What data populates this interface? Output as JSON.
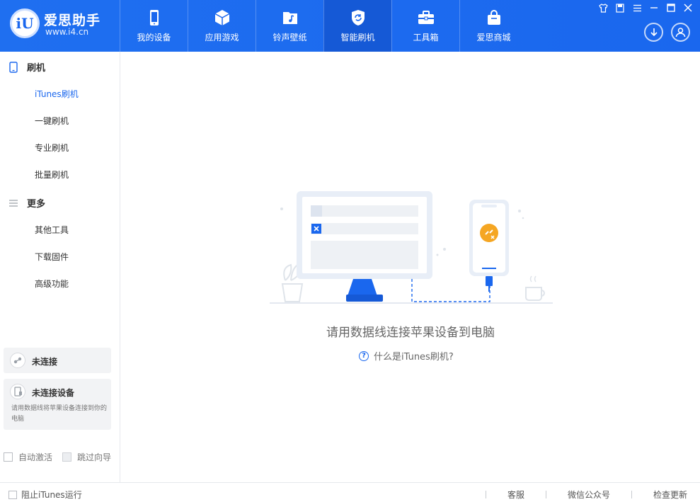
{
  "app": {
    "logo_text": "爱思助手",
    "logo_url": "www.i4.cn",
    "logo_badge": "iU"
  },
  "nav": [
    {
      "label": "我的设备",
      "icon": "phone-icon"
    },
    {
      "label": "应用游戏",
      "icon": "cube-icon"
    },
    {
      "label": "铃声壁纸",
      "icon": "music-folder-icon"
    },
    {
      "label": "智能刷机",
      "icon": "refresh-shield-icon",
      "active": true
    },
    {
      "label": "工具箱",
      "icon": "toolbox-icon"
    },
    {
      "label": "爱思商城",
      "icon": "shopping-bag-icon"
    }
  ],
  "sidebar": {
    "section_flash": "刷机",
    "flash_items": [
      "iTunes刷机",
      "一键刷机",
      "专业刷机",
      "批量刷机"
    ],
    "section_more": "更多",
    "more_items": [
      "其他工具",
      "下载固件",
      "高级功能"
    ],
    "status_card": {
      "title": "未连接"
    },
    "device_card": {
      "title": "未连接设备",
      "desc": "请用数据线将苹果设备连接到你的电脑"
    },
    "auto_activate": "自动激活",
    "skip_guide": "跳过向导"
  },
  "main": {
    "message": "请用数据线连接苹果设备到电脑",
    "help_link": "什么是iTunes刷机?"
  },
  "footer": {
    "block_itunes": "阻止iTunes运行",
    "links": [
      "客服",
      "微信公众号",
      "检查更新"
    ]
  },
  "colors": {
    "brand": "#1a67ee",
    "nav_active": "#1559d6",
    "accent_orange": "#f5a623"
  }
}
